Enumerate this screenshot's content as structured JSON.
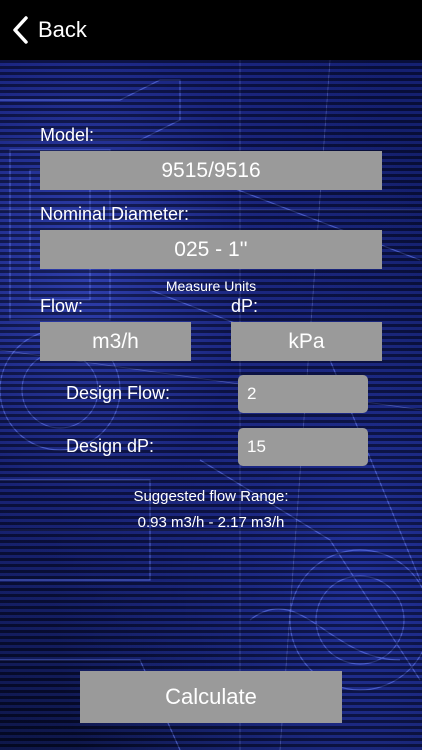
{
  "nav": {
    "back_label": "Back"
  },
  "form": {
    "model_label": "Model:",
    "model_value": "9515/9516",
    "diameter_label": "Nominal Diameter:",
    "diameter_value": "025 - 1''",
    "measure_units_label": "Measure Units",
    "flow_label": "Flow:",
    "flow_unit": "m3/h",
    "dp_label": "dP:",
    "dp_unit": "kPa",
    "design_flow_label": "Design Flow:",
    "design_flow_value": "2",
    "design_dp_label": "Design dP:",
    "design_dp_value": "15"
  },
  "result": {
    "title": "Suggested flow Range:",
    "range": "0.93 m3/h - 2.17 m3/h"
  },
  "actions": {
    "calculate_label": "Calculate"
  },
  "colors": {
    "nav_background": "#000000",
    "field_background": "#9a9a9a",
    "text": "#ffffff",
    "background_blue": "#0f1a6a"
  },
  "icons": {
    "back": "chevron-left-icon"
  }
}
